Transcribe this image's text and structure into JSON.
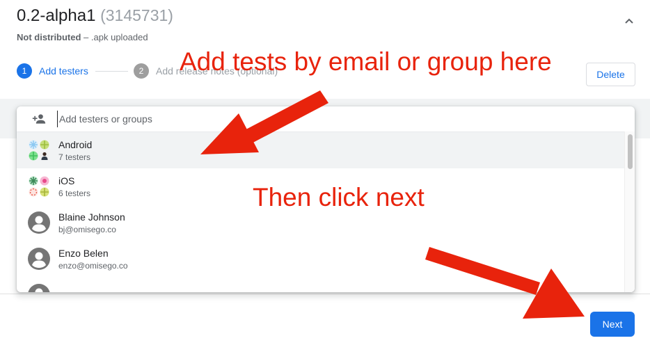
{
  "release": {
    "version": "0.2-alpha1",
    "build": "(3145731)",
    "status": "Not distributed",
    "separator": " – ",
    "detail": ".apk uploaded"
  },
  "stepper": {
    "steps": [
      {
        "number": "1",
        "label": "Add testers"
      },
      {
        "number": "2",
        "label": "Add release notes (optional)"
      }
    ]
  },
  "actions": {
    "delete_label": "Delete",
    "next_label": "Next"
  },
  "picker": {
    "placeholder": "Add testers or groups",
    "items": [
      {
        "title": "Android",
        "subtitle": "7 testers",
        "icon": "group-icon"
      },
      {
        "title": "iOS",
        "subtitle": "6 testers",
        "icon": "group-icon"
      },
      {
        "title": "Blaine Johnson",
        "subtitle": "bj@omisego.co",
        "icon": "account-circle-icon"
      },
      {
        "title": "Enzo Belen",
        "subtitle": "enzo@omisego.co",
        "icon": "account-circle-icon"
      },
      {
        "title": "",
        "subtitle": "",
        "icon": "account-circle-icon"
      }
    ]
  },
  "annotations": {
    "top": "Add tests by email or group here",
    "middle": "Then click next",
    "color": "#e8230c"
  },
  "colors": {
    "accent": "#1a73e8",
    "step_inactive": "#9e9e9e",
    "band": "#f1f3f4"
  }
}
